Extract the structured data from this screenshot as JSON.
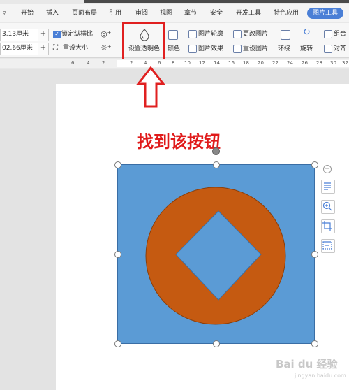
{
  "menu": {
    "items": [
      "开始",
      "插入",
      "页面布局",
      "引用",
      "审阅",
      "视图",
      "章节",
      "安全",
      "开发工具",
      "特色应用"
    ],
    "active": "图片工具",
    "collapse_glyph": "▿"
  },
  "toolbar": {
    "height_value": "3.13厘米",
    "width_value": "02.66厘米",
    "lock_ratio_label": "锁定纵横比",
    "reset_size_label": "重设大小",
    "set_transparent_label": "设置透明色",
    "color_label": "颜色",
    "picture_outline_label": "图片轮廓",
    "picture_effect_label": "图片效果",
    "change_picture_label": "更改图片",
    "reset_picture_label": "重设图片",
    "wrap_label": "环绕",
    "rotate_label": "旋转",
    "group_label": "组合",
    "align_label": "对齐"
  },
  "ruler": {
    "numbers": [
      "6",
      "4",
      "2",
      "2",
      "4",
      "6",
      "8",
      "10",
      "12",
      "14",
      "16",
      "18",
      "20",
      "22",
      "24",
      "26",
      "28",
      "30",
      "32"
    ]
  },
  "annotation": {
    "caption": "找到该按钮"
  },
  "image": {
    "background_color": "#5b9bd5",
    "shape_color": "#c55a11"
  },
  "watermark": {
    "text": "Bai du 经验",
    "sub": "jingyan.baidu.com"
  },
  "colors": {
    "highlight": "#e02020",
    "accent": "#4a7fd6"
  }
}
